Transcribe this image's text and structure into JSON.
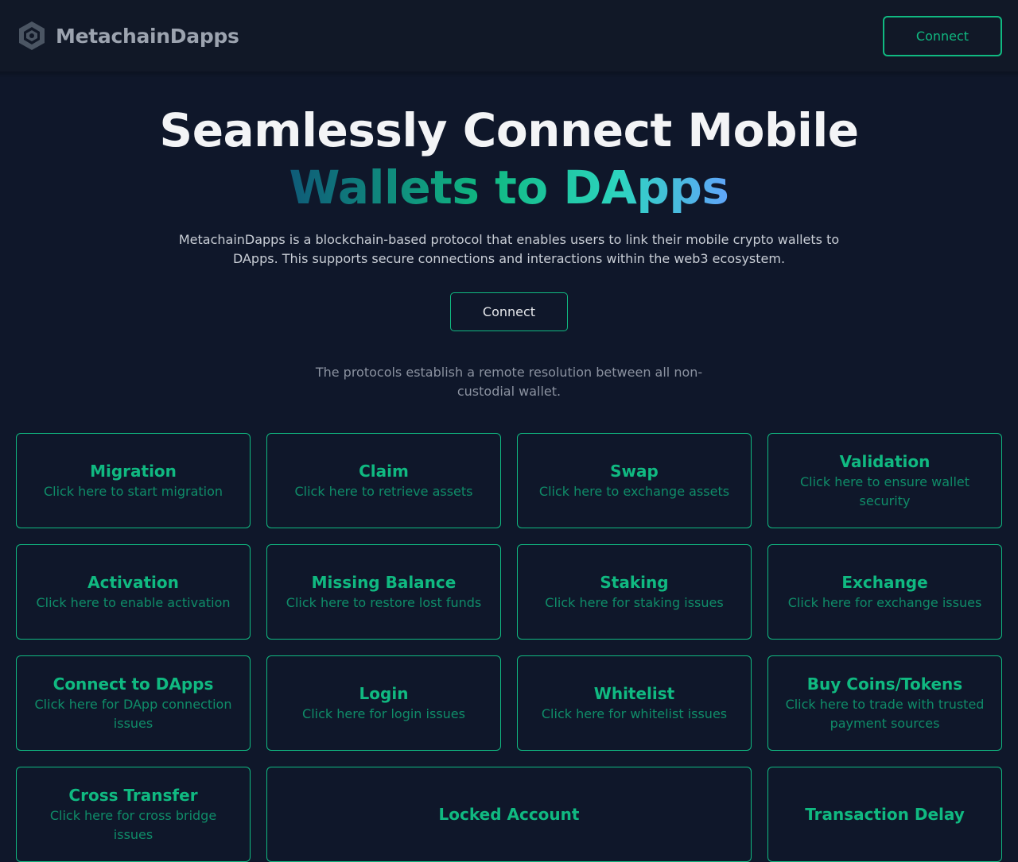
{
  "header": {
    "brand_name": "MetachainDapps",
    "connect_label": "Connect"
  },
  "hero": {
    "title_line1": "Seamlessly Connect Mobile",
    "title_line2": "Wallets to DApps",
    "description": "MetachainDapps is a blockchain-based protocol that enables users to link their mobile crypto wallets to DApps. This supports secure connections and interactions within the web3 ecosystem.",
    "connect_label": "Connect",
    "note": "The protocols establish a remote resolution between all non-custodial wallet."
  },
  "cards": [
    {
      "title": "Migration",
      "desc": "Click here to start migration"
    },
    {
      "title": "Claim",
      "desc": "Click here to retrieve assets"
    },
    {
      "title": "Swap",
      "desc": "Click here to exchange assets"
    },
    {
      "title": "Validation",
      "desc": "Click here to ensure wallet security"
    },
    {
      "title": "Activation",
      "desc": "Click here to enable activation"
    },
    {
      "title": "Missing Balance",
      "desc": "Click here to restore lost funds"
    },
    {
      "title": "Staking",
      "desc": "Click here for staking issues"
    },
    {
      "title": "Exchange",
      "desc": "Click here for exchange issues"
    },
    {
      "title": "Connect to DApps",
      "desc": "Click here for DApp connection issues"
    },
    {
      "title": "Login",
      "desc": "Click here for login issues"
    },
    {
      "title": "Whitelist",
      "desc": "Click here for whitelist issues"
    },
    {
      "title": "Buy Coins/Tokens",
      "desc": "Click here to trade with trusted payment sources"
    },
    {
      "title": "Cross Transfer",
      "desc": "Click here for cross bridge issues"
    },
    {
      "title": "Locked Account",
      "desc": ""
    },
    {
      "title": "Transaction Delay",
      "desc": ""
    }
  ],
  "colors": {
    "background": "#0f172a",
    "navbar": "#111827",
    "accent": "#10b981"
  },
  "icons": {
    "brand": "hexagon-logo-icon"
  }
}
